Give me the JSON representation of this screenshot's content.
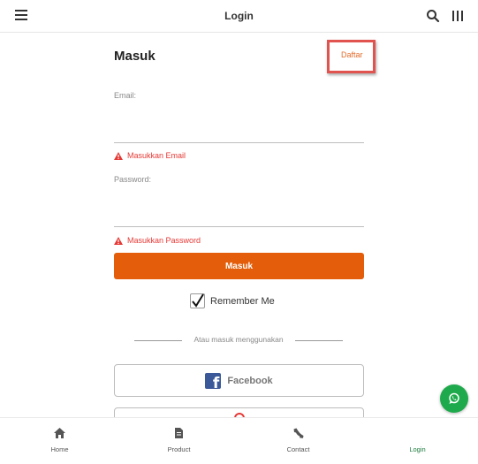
{
  "header": {
    "title": "Login",
    "icons": [
      "menu-icon",
      "search-icon",
      "columns-icon"
    ]
  },
  "form": {
    "heading": "Masuk",
    "register_link": "Daftar",
    "email_label": "Email:",
    "email_value": "",
    "email_error": "Masukkan Email",
    "password_label": "Password:",
    "password_value": "",
    "password_error": "Masukkan Password",
    "submit_label": "Masuk",
    "remember_label": "Remember Me",
    "remember_checked": true,
    "divider_text": "Atau masuk menggunakan",
    "facebook_label": "Facebook",
    "google_label": ""
  },
  "fab": {
    "icon": "whatsapp-icon",
    "color": "#1eaa4c"
  },
  "bottom_nav": {
    "items": [
      {
        "label": "Home",
        "icon": "home-icon"
      },
      {
        "label": "Product",
        "icon": "document-icon"
      },
      {
        "label": "Contact",
        "icon": "phone-icon"
      },
      {
        "label": "Login",
        "icon": "",
        "active": true
      }
    ]
  },
  "colors": {
    "accent": "#e35d0a",
    "error": "#e53935",
    "active_nav": "#1e7a3e",
    "facebook": "#3b5998"
  }
}
